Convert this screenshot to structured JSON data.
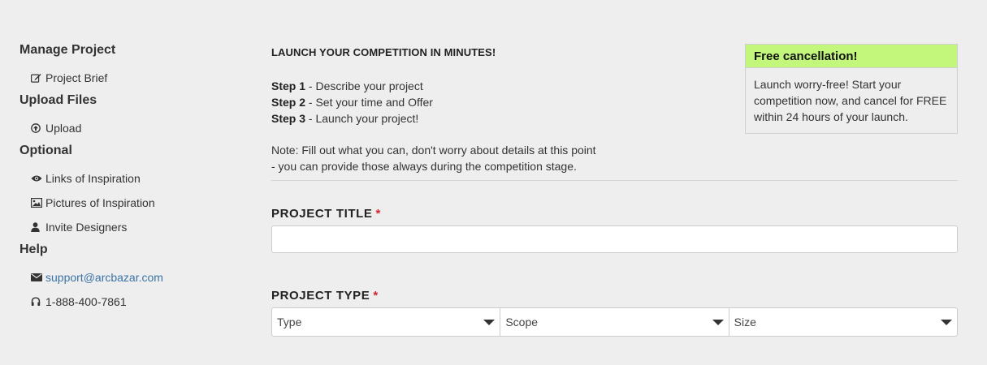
{
  "sidebar": {
    "manage": {
      "heading": "Manage Project",
      "items": [
        {
          "label": "Project Brief",
          "icon": "edit-icon"
        }
      ]
    },
    "upload": {
      "heading": "Upload Files",
      "items": [
        {
          "label": "Upload",
          "icon": "upload-circle-icon"
        }
      ]
    },
    "optional": {
      "heading": "Optional",
      "items": [
        {
          "label": "Links of Inspiration",
          "icon": "eye-icon"
        },
        {
          "label": "Pictures of Inspiration",
          "icon": "picture-icon"
        },
        {
          "label": "Invite Designers",
          "icon": "user-icon"
        }
      ]
    },
    "help": {
      "heading": "Help",
      "email": "support@arcbazar.com",
      "phone": "1-888-400-7861"
    }
  },
  "intro": {
    "title": "LAUNCH YOUR COMPETITION IN MINUTES!",
    "steps": [
      {
        "label": "Step 1",
        "text": " - Describe your project"
      },
      {
        "label": "Step 2",
        "text": " - Set your time and Offer"
      },
      {
        "label": "Step 3",
        "text": " - Launch your project!"
      }
    ],
    "note_line1": "Note: Fill out what you can, don't worry about details at this point",
    "note_line2": "- you can provide those always during the competition stage."
  },
  "promo": {
    "heading": "Free cancellation!",
    "body": "Launch worry-free! Start your competition now, and cancel for FREE within 24 hours of your launch.",
    "accent_color": "#c2f77c"
  },
  "form": {
    "title_label": "PROJECT TITLE",
    "title_value": "",
    "required_mark": "*",
    "type_label": "PROJECT TYPE",
    "selects": [
      {
        "value": "Type"
      },
      {
        "value": "Scope"
      },
      {
        "value": "Size"
      }
    ]
  },
  "colors": {
    "required": "#d9232d",
    "link": "#3b73a8"
  }
}
